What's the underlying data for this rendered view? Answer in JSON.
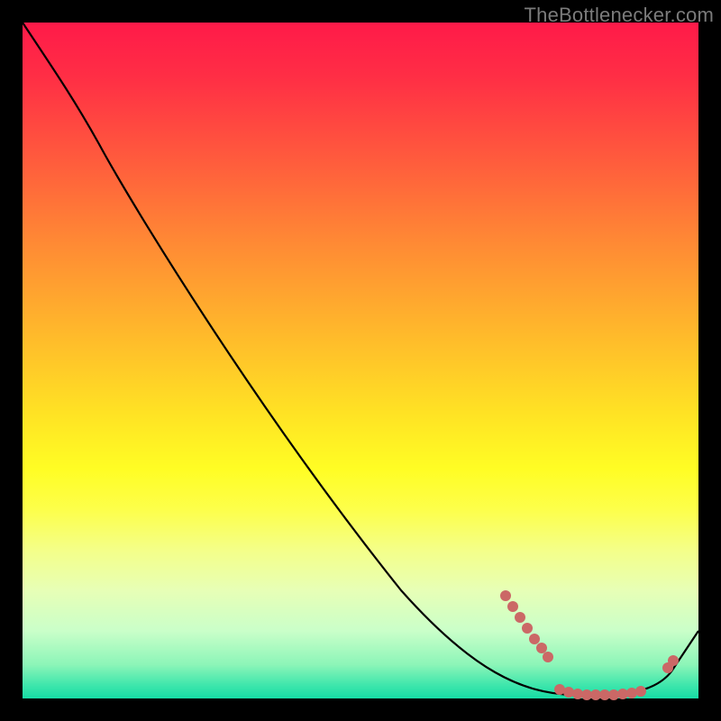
{
  "watermark": "TheBottlenecker.com",
  "colors": {
    "frame_bg": "#000000",
    "curve": "#000000",
    "marker": "#cb6866",
    "gradient_top": "#ff1a49",
    "gradient_mid": "#ffe324",
    "gradient_bottom": "#16dca5",
    "watermark_text": "#7b7b7b"
  },
  "chart_data": {
    "type": "line",
    "title": "",
    "xlabel": "",
    "ylabel": "",
    "xlim": [
      0,
      100
    ],
    "ylim": [
      0,
      100
    ],
    "series": [
      {
        "name": "curve",
        "x": [
          0,
          5,
          11,
          25,
          40,
          56,
          70,
          81,
          88,
          93,
          96,
          100
        ],
        "y": [
          100,
          94,
          82,
          60,
          40,
          16,
          5,
          0.7,
          0.5,
          0.7,
          4,
          10
        ]
      }
    ],
    "markers": [
      {
        "x": 71.5,
        "y": 15.2
      },
      {
        "x": 72.5,
        "y": 13.6
      },
      {
        "x": 73.6,
        "y": 12.0
      },
      {
        "x": 74.7,
        "y": 10.4
      },
      {
        "x": 75.7,
        "y": 8.8
      },
      {
        "x": 76.8,
        "y": 7.5
      },
      {
        "x": 77.7,
        "y": 6.1
      },
      {
        "x": 79.5,
        "y": 1.3
      },
      {
        "x": 80.8,
        "y": 0.9
      },
      {
        "x": 82.1,
        "y": 0.7
      },
      {
        "x": 83.5,
        "y": 0.5
      },
      {
        "x": 84.8,
        "y": 0.5
      },
      {
        "x": 86.1,
        "y": 0.5
      },
      {
        "x": 87.5,
        "y": 0.7
      },
      {
        "x": 88.8,
        "y": 0.8
      },
      {
        "x": 90.1,
        "y": 1.1
      },
      {
        "x": 91.5,
        "y": 1.3
      },
      {
        "x": 95.5,
        "y": 4.5
      },
      {
        "x": 96.3,
        "y": 5.6
      }
    ],
    "notes": "x and y are 0–100 percentage scale estimated from image (no axes/labels visible). Background is red→yellow→green vertical gradient; curve is monotone decreasing to a near-zero plateau then rises slightly at far right."
  }
}
